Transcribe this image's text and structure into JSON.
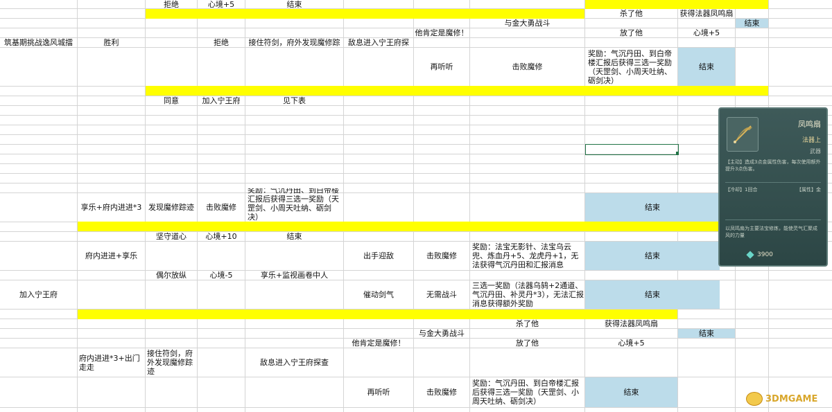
{
  "colors": {
    "highlight_yellow": "#ffff00",
    "end_fill": "#bcdcea",
    "grid": "#d4d4d4"
  },
  "rows": {
    "r1": {
      "refuse": "拒绝",
      "xinjing_plus5": "心境+5",
      "end": "结束"
    },
    "r2": {
      "kill_him": "杀了他",
      "get_weapon": "获得法器凤鸣扇"
    },
    "r3": {
      "fight_jin": "与金大勇战斗",
      "end": "结束"
    },
    "r4": {
      "is_demon": "他肯定是魔修！",
      "release": "放了他",
      "xinjing_plus5": "心境+5"
    },
    "r5": {
      "stage": "筑基期挑战逸风城擂",
      "win": "胜利",
      "refuse": "拒绝",
      "keep_sword": "接住符剑，府外发现魔修踪",
      "report": "敌息进入宁王府探"
    },
    "r6": {
      "listen_again": "再听听",
      "defeat_demon": "击败魔修",
      "reward": "奖励：气沉丹田、到白帝楼汇报后获得三选一奖励（天罡剑、小周天吐纳、砺剑决）",
      "end": "结束"
    },
    "r7": {
      "agree": "同意",
      "join_ning": "加入宁王府",
      "see_below": "见下表"
    },
    "r8": {
      "enjoy": "享乐+府内进进*3",
      "found_demon": "发现魔修踪迹",
      "defeat_demon": "击败魔修",
      "reward": "奖励：气沉丹田、到白帝楼汇报后获得三选一奖励（天罡剑、小周天吐纳、砺剑决）",
      "end": "结束"
    },
    "r9": {
      "keep_heart": "坚守道心",
      "xinjing_plus10": "心境+10",
      "end": "结束"
    },
    "r10": {
      "inner_enjoy": "府内进进+享乐",
      "take_action": "出手迎敌",
      "defeat_demon": "击败魔修",
      "reward": "奖励：法宝无影针、法宝乌云兜、炼血丹+5、龙虎丹+1，无法获得气沉丹田和汇报消息",
      "end": "结束"
    },
    "r11": {
      "indulge": "偶尔放纵",
      "xinjing_minus5": "心境-5",
      "scroll": "享乐+监视画卷中人"
    },
    "r12": {
      "join_ning": "加入宁王府",
      "urge_sword": "催动剑气",
      "no_fight": "无需战斗",
      "reward": "三选一奖励（法器乌鸫+2通道、气沉丹田、补灵丹*3），无法汇报消息获得额外奖励",
      "end": "结束"
    },
    "r13": {
      "kill_him": "杀了他",
      "get_weapon": "获得法器凤鸣扇"
    },
    "r14": {
      "fight_jin": "与金大勇战斗",
      "end": "结束"
    },
    "r15": {
      "is_demon": "他肯定是魔修！",
      "release": "放了他",
      "xinjing_plus5": "心境+5"
    },
    "r16": {
      "inner_out": "府内进进*3+出门走走",
      "keep_sword": "接住符剑，府外发现魔修踪迹",
      "report": "敌息进入宁王府探查"
    },
    "r17": {
      "listen_again": "再听听",
      "defeat_demon": "击败魔修",
      "reward": "奖励：气沉丹田、到白帝楼汇报后获得三选一奖励（天罡剑、小周天吐纳、砺剑决）",
      "end": "结束"
    }
  },
  "item_card": {
    "name": "凤鸣扇",
    "grade": "法器上",
    "type": "武器",
    "description": "【主动】造成3点金属性伤害，每次使用额外提升3点伤害。",
    "stat_left": "【冷却】1回合",
    "stat_right": "【属性】金",
    "footer": "以凤鸣扇为主要法宝修炼，能使灵气汇聚成风的力量",
    "price": "3900",
    "icon": "fan-icon"
  },
  "watermark": {
    "text": "3DMGAME",
    "icon": "3dm-logo-icon"
  }
}
